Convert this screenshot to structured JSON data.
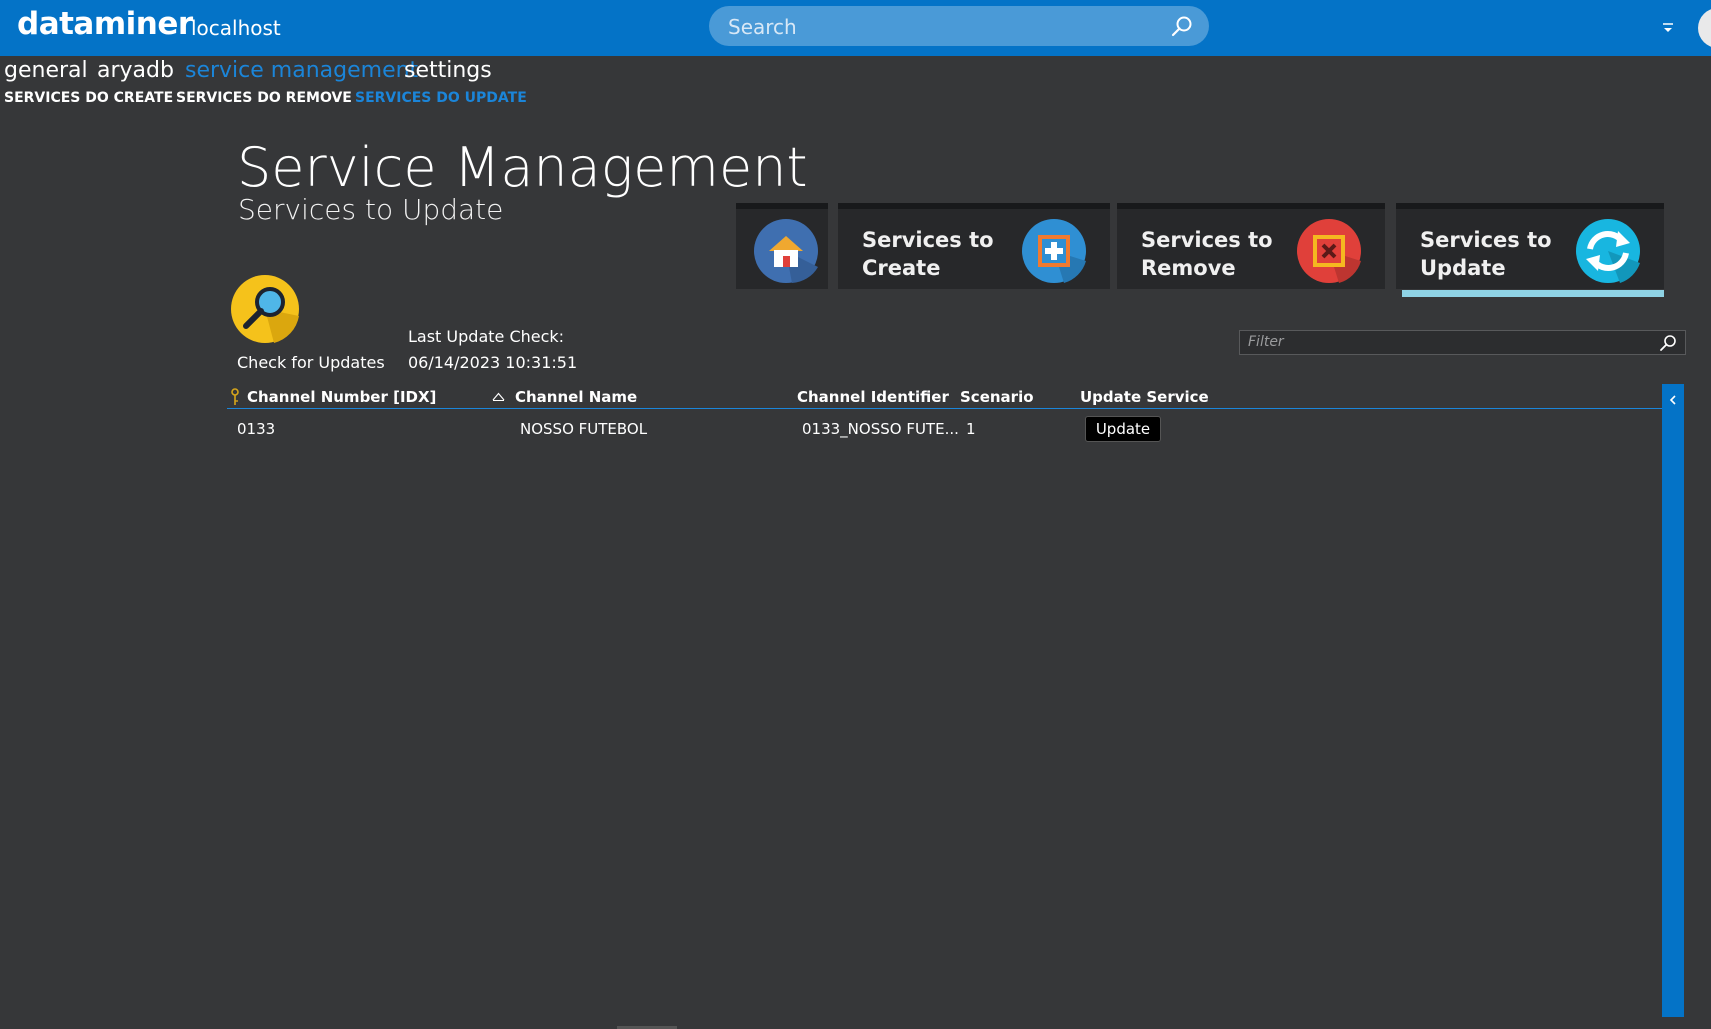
{
  "header": {
    "logo": "dataminer",
    "host": "localhost",
    "search_placeholder": "Search"
  },
  "nav": {
    "tabs": [
      "general",
      "aryadb",
      "service management",
      "settings"
    ],
    "active_tab": "service management",
    "subtabs": [
      "SERVICES DO CREATE",
      "SERVICES DO REMOVE",
      "SERVICES DO UPDATE"
    ],
    "active_subtab": "SERVICES DO UPDATE"
  },
  "page": {
    "title": "Service Management",
    "subtitle": "Services to Update"
  },
  "tiles": [
    {
      "name": "home",
      "label": "",
      "icon": "home-icon",
      "color": "#3f6fb0"
    },
    {
      "name": "create",
      "label_line1": "Services to",
      "label_line2": "Create",
      "icon": "plus-icon",
      "color": "#2f8fd3"
    },
    {
      "name": "remove",
      "label_line1": "Services to",
      "label_line2": "Remove",
      "icon": "remove-icon",
      "color": "#e0403a"
    },
    {
      "name": "update",
      "label_line1": "Services to",
      "label_line2": "Update",
      "icon": "refresh-icon",
      "color": "#18b6e0",
      "selected": true
    }
  ],
  "check": {
    "label": "Check for Updates",
    "last_label": "Last Update Check:",
    "last_value": "06/14/2023 10:31:51"
  },
  "filter": {
    "placeholder": "Filter"
  },
  "table": {
    "columns": [
      "Channel Number [IDX]",
      "Channel Name",
      "Channel Identifier",
      "Scenario",
      "Update Service"
    ],
    "rows": [
      {
        "channel_number": "0133",
        "channel_name": "NOSSO FUTEBOL",
        "channel_identifier": "0133_NOSSO FUTE...",
        "scenario": "1",
        "action": "Update"
      }
    ]
  }
}
